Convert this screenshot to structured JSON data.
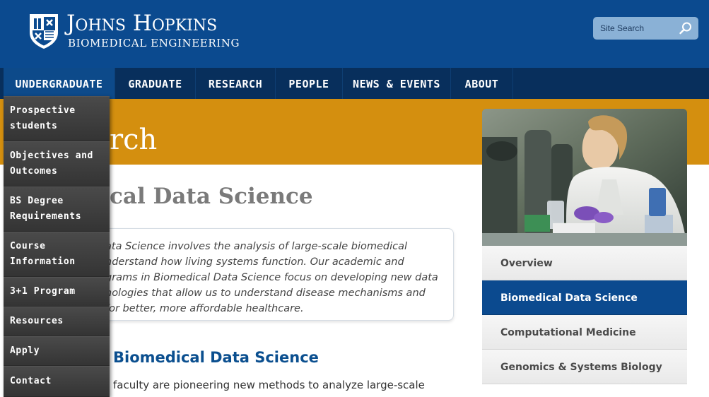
{
  "header": {
    "brand_line1": "Johns Hopkins",
    "brand_line2": "BIOMEDICAL ENGINEERING",
    "search_placeholder": "Site Search",
    "colors": {
      "header_bg": "#0b4a8f",
      "nav_bg": "#082f5c",
      "band": "#d48f0f",
      "active_subnav": "#0b4a8f"
    }
  },
  "nav": {
    "items": [
      {
        "label": "UNDERGRADUATE"
      },
      {
        "label": "GRADUATE"
      },
      {
        "label": "RESEARCH"
      },
      {
        "label": "PEOPLE"
      },
      {
        "label": "NEWS & EVENTS"
      },
      {
        "label": "ABOUT"
      }
    ]
  },
  "dropdown": {
    "items": [
      {
        "label": "Prospective\nstudents"
      },
      {
        "label": "Objectives and\nOutcomes"
      },
      {
        "label": "BS Degree\nRequirements"
      },
      {
        "label": "Course\nInformation"
      },
      {
        "label": "3+1 Program"
      },
      {
        "label": "Resources"
      },
      {
        "label": "Apply"
      },
      {
        "label": "Contact"
      }
    ]
  },
  "band": {
    "title": "rch"
  },
  "main": {
    "page_title": "cal Data Science",
    "intro_lines": [
      "ata Science involves the analysis of large-scale biomedical",
      "nderstand how living systems function. Our academic and",
      "grams in Biomedical Data Science focus on developing new data",
      "nologies that allow us to understand disease mechanisms and",
      "for better, more affordable healthcare."
    ],
    "section_heading": "Biomedical Data Science",
    "body_text": "faculty are pioneering new methods to analyze large-scale"
  },
  "subnav": {
    "items": [
      {
        "label": "Overview"
      },
      {
        "label": "Biomedical Data Science"
      },
      {
        "label": "Computational Medicine"
      },
      {
        "label": "Genomics & Systems Biology"
      }
    ]
  }
}
